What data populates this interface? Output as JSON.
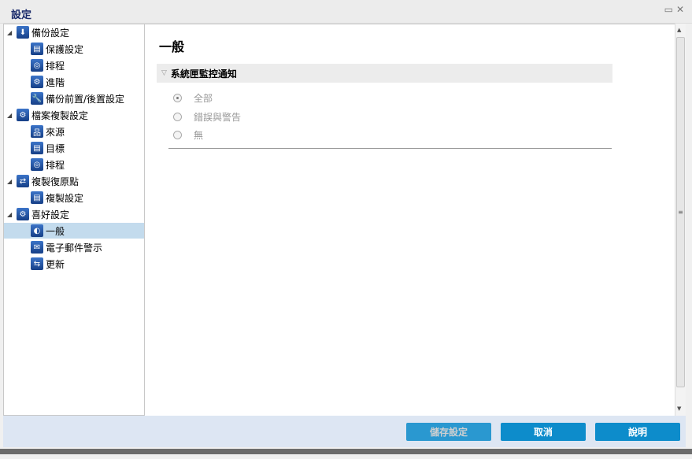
{
  "window": {
    "title": "設定",
    "restore_icon": "▭",
    "close_icon": "✕"
  },
  "tree": [
    {
      "label": "備份設定",
      "level": 0,
      "icon": "backup",
      "glyph": "⬇"
    },
    {
      "label": "保護設定",
      "level": 1,
      "icon": "protect",
      "glyph": "▤"
    },
    {
      "label": "排程",
      "level": 1,
      "icon": "schedule",
      "glyph": "◎"
    },
    {
      "label": "進階",
      "level": 1,
      "icon": "advanced",
      "glyph": "⚙"
    },
    {
      "label": "備份前置/後置設定",
      "level": 1,
      "icon": "wrench",
      "glyph": "🔧"
    },
    {
      "label": "檔案複製設定",
      "level": 0,
      "icon": "file-copy",
      "glyph": "⚙"
    },
    {
      "label": "來源",
      "level": 1,
      "icon": "source",
      "glyph": "品"
    },
    {
      "label": "目標",
      "level": 1,
      "icon": "destination",
      "glyph": "▤"
    },
    {
      "label": "排程",
      "level": 1,
      "icon": "schedule",
      "glyph": "◎"
    },
    {
      "label": "複製復原點",
      "level": 0,
      "icon": "copy-recovery",
      "glyph": "⇄"
    },
    {
      "label": "複製設定",
      "level": 1,
      "icon": "copy-settings",
      "glyph": "▤"
    },
    {
      "label": "喜好設定",
      "level": 0,
      "icon": "preferences",
      "glyph": "⚙"
    },
    {
      "label": "一般",
      "level": 1,
      "icon": "general",
      "glyph": "◐",
      "selected": true
    },
    {
      "label": "電子郵件警示",
      "level": 1,
      "icon": "email",
      "glyph": "✉"
    },
    {
      "label": "更新",
      "level": 1,
      "icon": "update",
      "glyph": "⇆"
    }
  ],
  "main": {
    "heading": "一般",
    "section": "系統匣監控通知",
    "options": [
      {
        "label": "全部",
        "checked": true
      },
      {
        "label": "錯誤與警告",
        "checked": false
      },
      {
        "label": "無",
        "checked": false
      }
    ]
  },
  "footer": {
    "save": "儲存設定",
    "cancel": "取消",
    "help": "說明"
  }
}
